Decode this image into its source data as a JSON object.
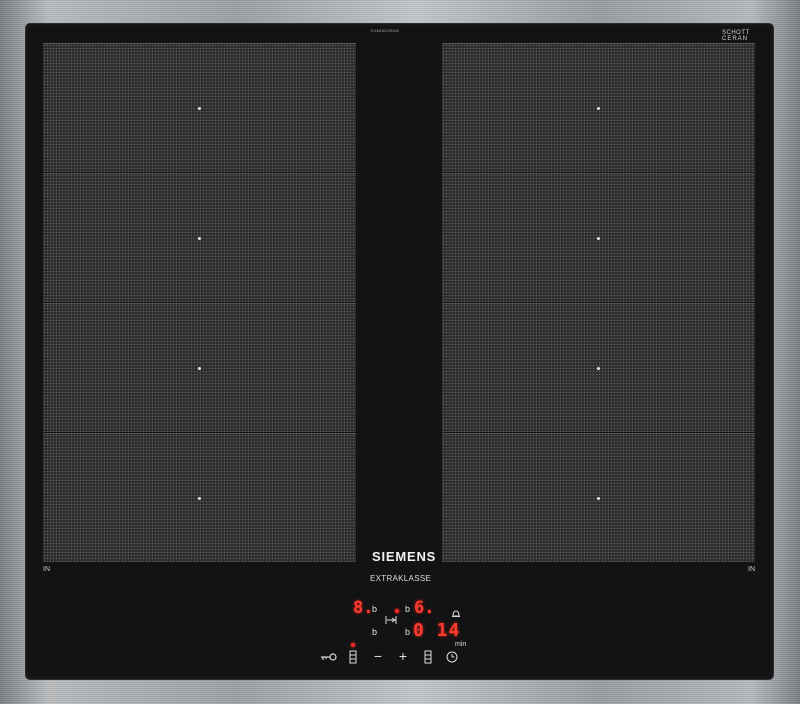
{
  "hob": {
    "model_code": "EX645CXB1M",
    "glass_brand_line1": "SCHOTT",
    "glass_brand_line2": "CERAN",
    "glass_brand_line3": "SCHOTT CERAN",
    "brand": "SIEMENS",
    "series": "EXTRAKLASSE",
    "left_label": "IN",
    "right_label": "IN",
    "zones_per_side": 4
  },
  "display": {
    "zone_left_digit": "8.",
    "zone_left_label": "b",
    "zone_right_label": "b",
    "zone_right_digit": "6.",
    "row2_left_label": "b",
    "row2_right_label": "b",
    "timer_digits": "0 14",
    "timer_unit": "min"
  },
  "controls": {
    "key_icon": "key-lock-icon",
    "left_zone_select_icon": "zone-select-icon",
    "minus_symbol": "−",
    "plus_symbol": "+",
    "right_zone_select_icon": "zone-select-icon",
    "timer_icon": "clock-icon",
    "alarm_icon": "bell-icon",
    "link_icon": "bridge-link-icon"
  },
  "colors": {
    "glass": "#121314",
    "zone_pattern": "#2c2d2f",
    "led_red": "#ff3b2f",
    "frame_steel": "#a9adb0"
  }
}
